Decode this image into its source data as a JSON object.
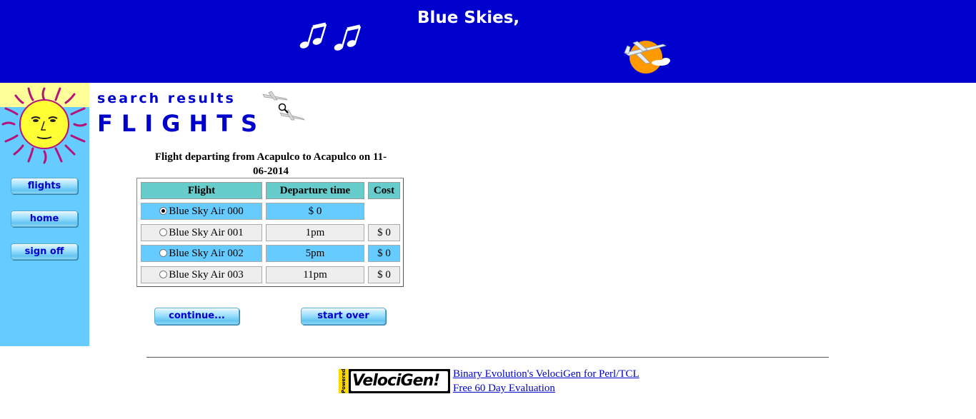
{
  "header": {
    "title": "Blue Skies,",
    "colors": {
      "background": "#0000cc",
      "text": "#ffffff"
    },
    "icons": [
      "music-notes-icon",
      "plane-sun-icon"
    ]
  },
  "sidebar": {
    "background": "#66ccff",
    "logo_icon": "sun-face-icon",
    "buttons": [
      {
        "label": "flights"
      },
      {
        "label": "home"
      },
      {
        "label": "sign off"
      }
    ]
  },
  "page": {
    "subtitle": "search results",
    "title": "FLIGHTS",
    "title_icon": "planes-magnifier-icon"
  },
  "results": {
    "heading": "Flight departing from Acapulco to Acapulco on 11-06-2014",
    "columns": [
      "Flight",
      "Departure time",
      "Cost"
    ],
    "rows": [
      {
        "flight": "Blue Sky Air 000",
        "time": "$ 0",
        "cost": "",
        "selected": true
      },
      {
        "flight": "Blue Sky Air 001",
        "time": "1pm",
        "cost": "$ 0",
        "selected": false
      },
      {
        "flight": "Blue Sky Air 002",
        "time": "5pm",
        "cost": "$ 0",
        "selected": false
      },
      {
        "flight": "Blue Sky Air 003",
        "time": "11pm",
        "cost": "$ 0",
        "selected": false
      }
    ]
  },
  "actions": {
    "continue_label": "continue...",
    "start_over_label": "start over"
  },
  "footer": {
    "logo_powered": "Powered By",
    "logo_text": "VelociGen!",
    "link1": "Binary Evolution's VelociGen for Perl/TCL",
    "link2": "Free 60 Day Evaluation"
  }
}
